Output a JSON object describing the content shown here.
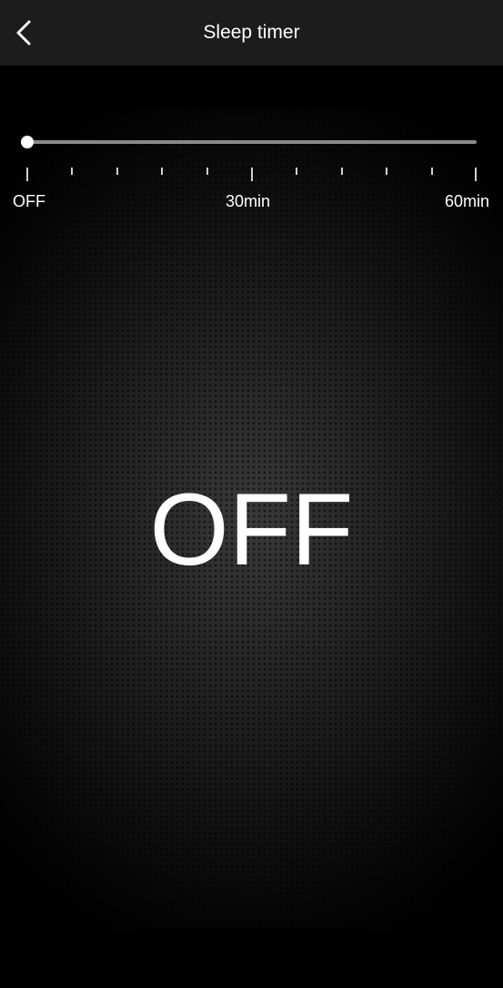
{
  "header": {
    "title": "Sleep timer",
    "back_icon": "chevron-left-icon"
  },
  "slider": {
    "value_minutes": 0,
    "min_minutes": 0,
    "max_minutes": 60,
    "labels": {
      "start": "OFF",
      "middle": "30min",
      "end": "60min"
    }
  },
  "status": {
    "display": "OFF"
  },
  "colors": {
    "header_bg": "#1c1c1c",
    "track": "#8a8a8a",
    "thumb": "#ffffff",
    "text": "#ffffff"
  }
}
